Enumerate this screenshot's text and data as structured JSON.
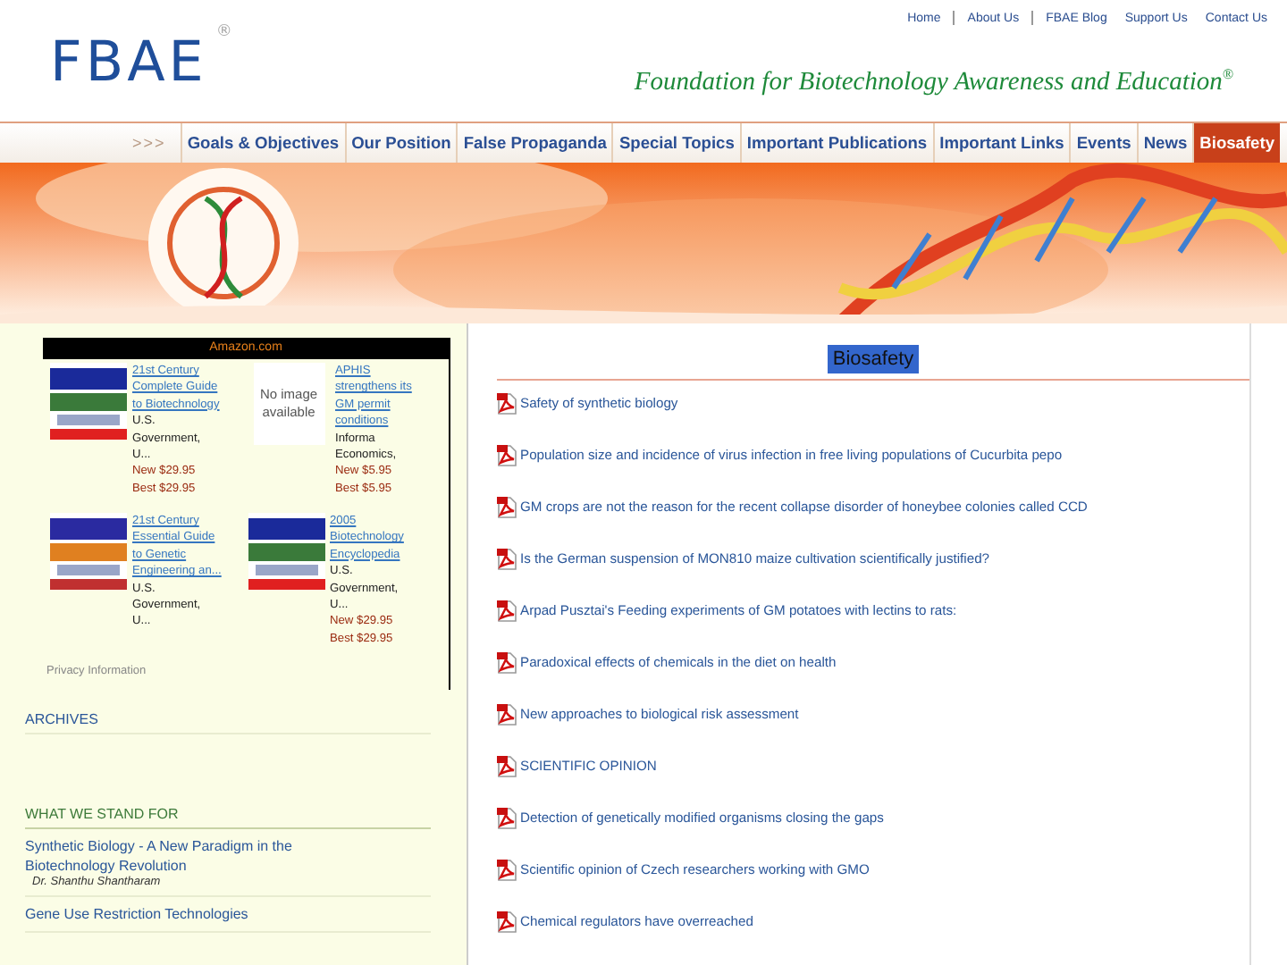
{
  "top_links": [
    {
      "label": "Home"
    },
    {
      "label": "About Us"
    },
    {
      "label": "FBAE Blog"
    },
    {
      "label": "Support Us"
    },
    {
      "label": "Contact Us"
    }
  ],
  "logo": {
    "text": "FBAE",
    "mark": "®"
  },
  "tagline": {
    "text": "Foundation for Biotechnology Awareness and Education",
    "mark": "®"
  },
  "nav": {
    "arrows": ">>>",
    "items": [
      {
        "label": "Goals & Objectives",
        "selected": false
      },
      {
        "label": "Our Position",
        "selected": false
      },
      {
        "label": "False Propaganda",
        "selected": false
      },
      {
        "label": "Special Topics",
        "selected": false
      },
      {
        "label": "Important Publications",
        "selected": false
      },
      {
        "label": "Important Links",
        "selected": false
      },
      {
        "label": "Events",
        "selected": false
      },
      {
        "label": "News",
        "selected": false
      },
      {
        "label": "Biosafety",
        "selected": true
      }
    ]
  },
  "amazon": {
    "title": "Amazon.com",
    "products": [
      {
        "kind": "cover",
        "title": "21st Century Complete Guide to Biotechnology",
        "lines": [
          "U.S. Government, U..."
        ],
        "new_price": "New $29.95",
        "best_price": "Best $29.95"
      },
      {
        "kind": "no_image",
        "image_text": "No image available",
        "title": "APHIS strengthens its GM permit conditions",
        "lines": [
          "Informa Economics,"
        ],
        "new_price": "New $5.95",
        "best_price": "Best $5.95"
      },
      {
        "kind": "cover",
        "title": "21st Century Essential Guide to Genetic Engineering an...",
        "lines": [
          "U.S. Government, U..."
        ]
      },
      {
        "kind": "cover",
        "title": "2005 Biotechnology Encyclopedia",
        "lines": [
          "U.S. Government, U..."
        ],
        "new_price": "New $29.95",
        "best_price": "Best $29.95"
      }
    ],
    "privacy": "Privacy Information"
  },
  "sidebar": {
    "archives": "ARCHIVES",
    "stand_heading": "WHAT WE STAND FOR",
    "articles": [
      {
        "title": "Synthetic Biology - A New Paradigm in the Biotechnology Revolution",
        "author": "Dr. Shanthu Shantharam"
      },
      {
        "title": "Gene Use Restriction Technologies"
      }
    ]
  },
  "main": {
    "heading": "Biosafety",
    "documents": [
      {
        "title": "Safety of synthetic biology"
      },
      {
        "title": "Population size and incidence of virus infection in free living populations of Cucurbita pepo"
      },
      {
        "title": "GM crops are not the reason for the recent collapse disorder of honeybee colonies called CCD"
      },
      {
        "title": "Is the German suspension of MON810 maize cultivation scientifically justified?"
      },
      {
        "title": "Arpad Pusztai's Feeding experiments of GM potatoes with lectins to rats:"
      },
      {
        "title": "Paradoxical effects of chemicals in the diet on health"
      },
      {
        "title": "New approaches to biological risk assessment"
      },
      {
        "title": "SCIENTIFIC OPINION"
      },
      {
        "title": "Detection of genetically modified organisms closing the gaps"
      },
      {
        "title": "Scientific opinion of Czech researchers working with GMO"
      },
      {
        "title": "Chemical regulators have overreached"
      }
    ]
  }
}
